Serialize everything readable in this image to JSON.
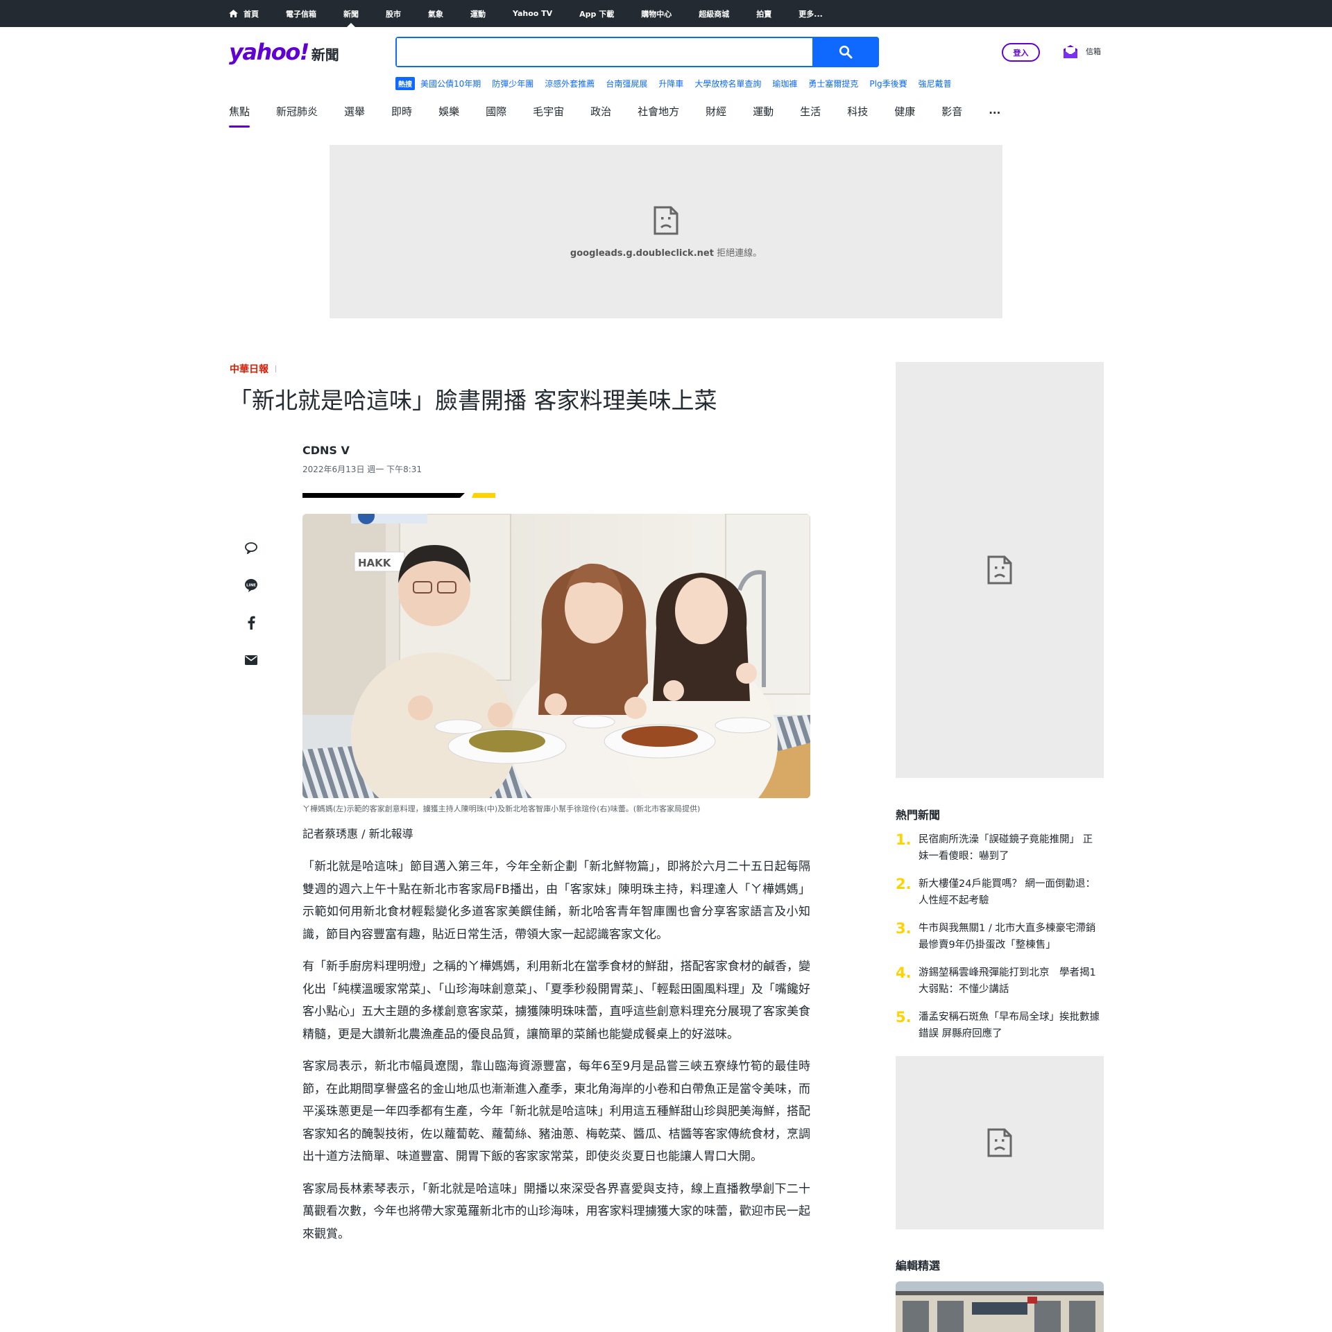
{
  "topnav": {
    "items": [
      "首頁",
      "電子信箱",
      "新聞",
      "股市",
      "氣象",
      "運動",
      "Yahoo TV",
      "App 下載",
      "購物中心",
      "超級商城",
      "拍賣",
      "更多..."
    ],
    "active_index": 2
  },
  "header": {
    "logo": "yahoo!",
    "logo_section": "新聞",
    "search_placeholder": "",
    "login_label": "登入",
    "mail_label": "信箱"
  },
  "trending": {
    "badge": "熱搜",
    "items": [
      "美國公債10年期",
      "防彈少年團",
      "涼感外套推薦",
      "台南彊屍展",
      "升降車",
      "大學放榜名單查詢",
      "瑜珈褲",
      "勇士塞爾提克",
      "Plg季後賽",
      "強尼戴普"
    ]
  },
  "categories": {
    "items": [
      "焦點",
      "新冠肺炎",
      "選舉",
      "即時",
      "娛樂",
      "國際",
      "毛宇宙",
      "政治",
      "社會地方",
      "財經",
      "運動",
      "生活",
      "科技",
      "健康",
      "影音",
      "..."
    ],
    "active_index": 0
  },
  "ad_top": {
    "domain": "googleads.g.doubleclick.net",
    "message": " 拒絕連線。"
  },
  "article": {
    "source_name": "中華日報",
    "title": "「新北就是哈這味」臉書開播 客家料理美味上菜",
    "author": "CDNS V",
    "date": "2022年6月13日 週一 下午8:31",
    "caption": "ㄚ樺媽媽(左)示範的客家創意料理，擄獲主持人陳明珠(中)及新北哈客智庫小幫手徐瑄伶(右)味蕾。(新北市客家局提供)",
    "reporter": "記者蔡琇惠 / 新北報導",
    "paragraphs": [
      "「新北就是哈這味」節目邁入第三年，今年全新企劃「新北鮮物篇」，即將於六月二十五日起每隔雙週的週六上午十點在新北市客家局FB播出，由「客家妹」陳明珠主持，料理達人「ㄚ樺媽媽」示範如何用新北食材輕鬆變化多道客家美饌佳餚，新北哈客青年智庫團也會分享客家語言及小知識，節目內容豐富有趣，貼近日常生活，帶領大家一起認識客家文化。",
      "有「新手廚房料理明燈」之稱的ㄚ樺媽媽，利用新北在當季食材的鮮甜，搭配客家食材的鹹香，變化出「純樸溫暖家常菜」、「山珍海味創意菜」、「夏季秒殺開胃菜」、「輕鬆田園風料理」及「嘴饞好客小點心」五大主題的多樣創意客家菜，擄獲陳明珠味蕾，直呼這些創意料理充分展現了客家美食精髓，更是大讚新北農漁產品的優良品質，讓簡單的菜餚也能變成餐桌上的好滋味。",
      "客家局表示，新北市幅員遼闊，靠山臨海資源豐富，每年6至9月是品嘗三峽五寮綠竹筍的最佳時節，在此期間享譽盛名的金山地瓜也漸漸進入產季，東北角海岸的小卷和白帶魚正是當令美味，而平溪珠蔥更是一年四季都有生產，今年「新北就是哈這味」利用這五種鮮甜山珍與肥美海鮮，搭配客家知名的醃製技術，佐以蘿蔔乾、蘿蔔絲、豬油蔥、梅乾菜、醬瓜、桔醬等客家傳統食材，烹調出十道方法簡單、味道豐富、開胃下飯的客家家常菜，即使炎炎夏日也能讓人胃口大開。",
      "客家局長林素琴表示，「新北就是哈這味」開播以來深受各界喜愛與支持，線上直播教學創下二十萬觀看次數，今年也將帶大家蒐羅新北市的山珍海味，用客家料理擄獲大家的味蕾，歡迎市民一起來觀賞。"
    ]
  },
  "photo_sign": "HAKK",
  "rail": {
    "hot_title": "熱門新聞",
    "hot_items": [
      {
        "num": "1.",
        "text": "民宿廁所洗澡「誤碰鏡子竟能推開」 正妹一看傻眼：嚇到了"
      },
      {
        "num": "2.",
        "text": "新大樓僅24戶能買嗎？ 網一面倒勸退：人性經不起考驗"
      },
      {
        "num": "3.",
        "text": "牛市與我無關1 / 北市大直多棟豪宅滯銷　最慘賣9年仍掛蛋改「整棟售」"
      },
      {
        "num": "4.",
        "text": "游錫堃稱雲峰飛彈能打到北京　學者揭1大弱點：不懂少講話"
      },
      {
        "num": "5.",
        "text": "潘孟安稱石斑魚「早布局全球」挨批數據錯誤 屏縣府回應了"
      }
    ],
    "editor_title": "編輯精選"
  },
  "colors": {
    "topbar": "#232a31",
    "brand": "#6001d2",
    "search_blue": "#0f69ff",
    "accent_yellow": "#ffd200",
    "ad_gray": "#ebebeb"
  },
  "icons": [
    "home-icon",
    "search-icon",
    "mail-icon",
    "sad-page-icon",
    "comment-icon",
    "line-icon",
    "facebook-icon",
    "email-icon"
  ]
}
